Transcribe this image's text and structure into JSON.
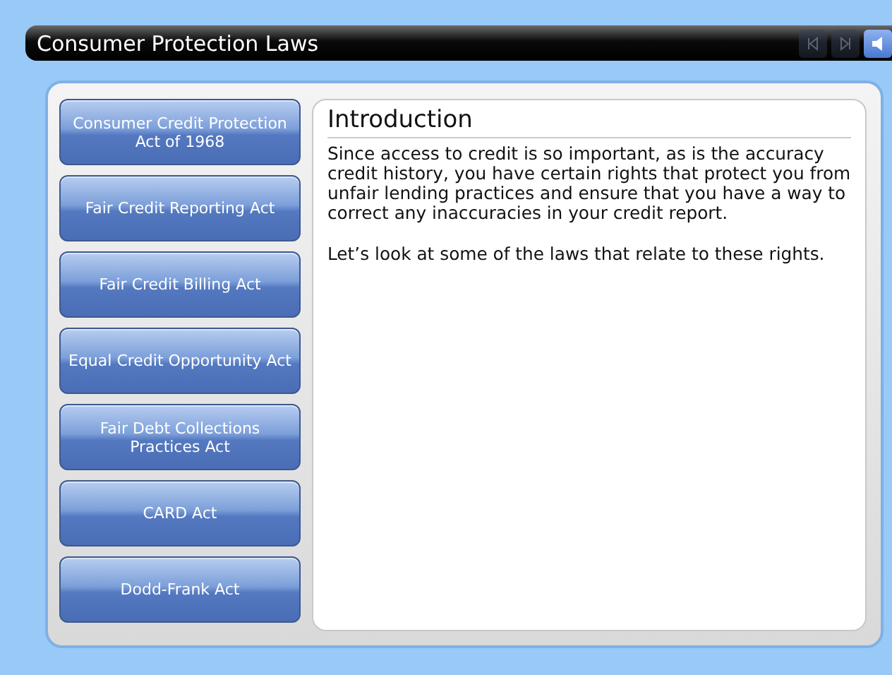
{
  "title": "Consumer Protection Laws",
  "nav_buttons": [
    {
      "kind": "back",
      "disabled": true
    },
    {
      "kind": "forward",
      "disabled": true
    },
    {
      "kind": "sound",
      "disabled": false
    }
  ],
  "topics": [
    {
      "label": "Consumer Credit Protection Act of 1968"
    },
    {
      "label": "Fair Credit Reporting Act"
    },
    {
      "label": "Fair Credit Billing Act"
    },
    {
      "label": "Equal Credit Opportunity Act"
    },
    {
      "label": "Fair Debt Collections Practices Act"
    },
    {
      "label": "CARD Act"
    },
    {
      "label": "Dodd-Frank Act"
    }
  ],
  "content": {
    "heading": "Introduction",
    "paragraphs": [
      "Since access to credit is so important, as is the accuracy credit history, you have certain rights that protect you from unfair lending practices and ensure that you have a way to correct any inaccuracies in your credit report.",
      "Let’s look at some of the laws that relate to these rights."
    ]
  }
}
